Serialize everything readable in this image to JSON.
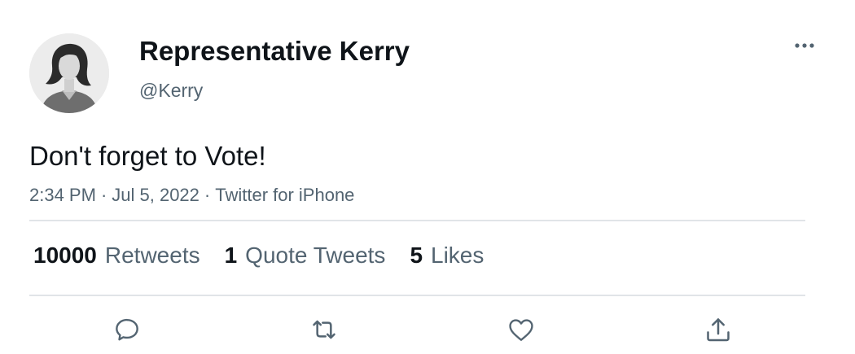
{
  "author": {
    "display_name": "Representative Kerry",
    "handle": "@Kerry",
    "avatar_icon": "default-avatar-woman-icon"
  },
  "tweet": {
    "text": "Don't forget to Vote!",
    "time": "2:34 PM",
    "date": "Jul 5, 2022",
    "source": "Twitter for iPhone",
    "separator": "·"
  },
  "stats": {
    "retweets": {
      "count": "10000",
      "label": "Retweets"
    },
    "quote_tweets": {
      "count": "1",
      "label": "Quote Tweets"
    },
    "likes": {
      "count": "5",
      "label": "Likes"
    }
  },
  "actions": {
    "reply_icon": "speech-bubble-icon",
    "retweet_icon": "retweet-arrows-icon",
    "like_icon": "heart-icon",
    "share_icon": "share-upload-icon",
    "more_icon": "ellipsis-icon"
  },
  "colors": {
    "text_primary": "#0f1419",
    "text_secondary": "#536471",
    "icon": "#536471",
    "divider": "#e1e4e8"
  }
}
